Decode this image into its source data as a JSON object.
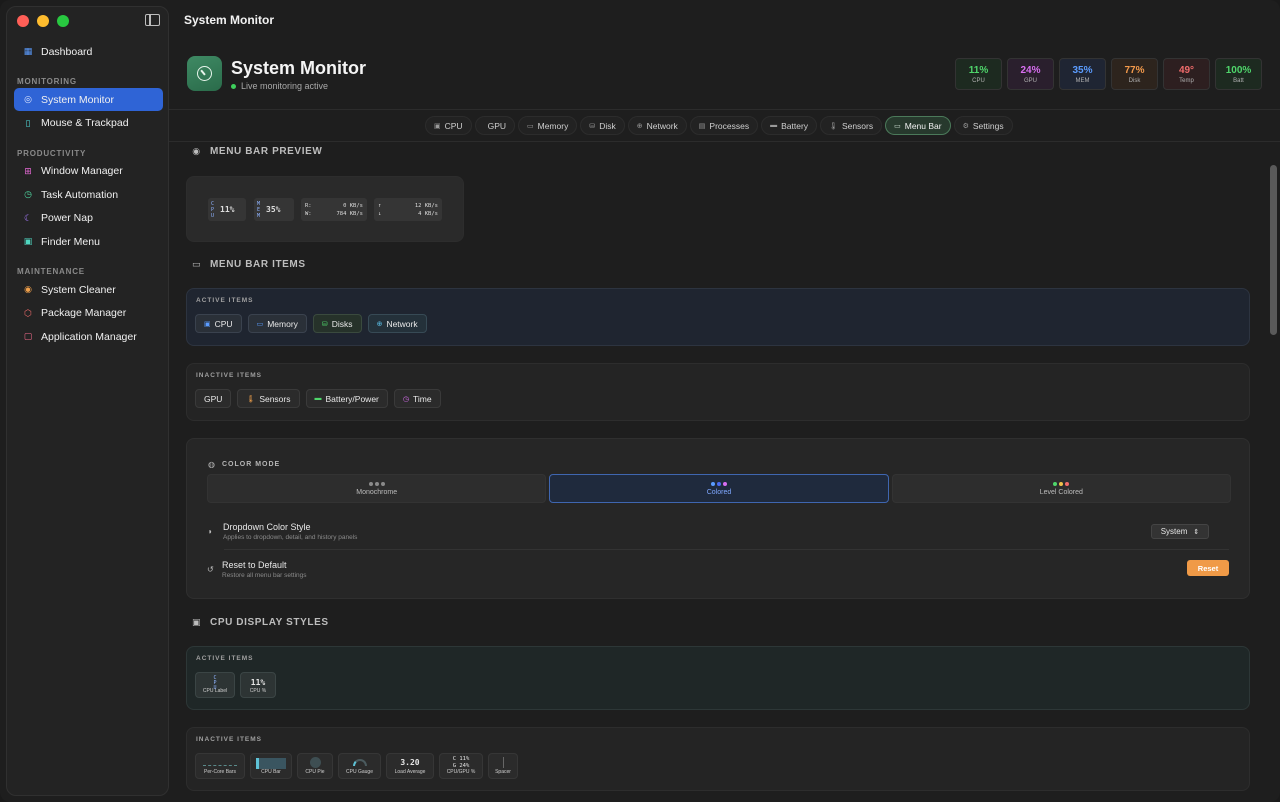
{
  "window": {
    "title": "System Monitor"
  },
  "sidebar": {
    "top": [
      {
        "label": "Dashboard",
        "icon": "grid-icon"
      }
    ],
    "sections": [
      {
        "title": "MONITORING",
        "items": [
          {
            "label": "System Monitor",
            "icon": "gauge-icon",
            "active": true
          },
          {
            "label": "Mouse & Trackpad",
            "icon": "mouse-icon"
          }
        ]
      },
      {
        "title": "PRODUCTIVITY",
        "items": [
          {
            "label": "Window Manager",
            "icon": "windows-icon"
          },
          {
            "label": "Task Automation",
            "icon": "clock-icon"
          },
          {
            "label": "Power Nap",
            "icon": "moon-icon"
          },
          {
            "label": "Finder Menu",
            "icon": "finder-icon"
          }
        ]
      },
      {
        "title": "MAINTENANCE",
        "items": [
          {
            "label": "System Cleaner",
            "icon": "broom-icon"
          },
          {
            "label": "Package Manager",
            "icon": "package-icon"
          },
          {
            "label": "Application Manager",
            "icon": "app-icon"
          }
        ]
      }
    ]
  },
  "header": {
    "title": "System Monitor",
    "status": "Live monitoring active",
    "stats": [
      {
        "value": "11%",
        "label": "CPU",
        "color": "#4fd66b"
      },
      {
        "value": "24%",
        "label": "GPU",
        "color": "#d86ef0"
      },
      {
        "value": "35%",
        "label": "MEM",
        "color": "#5b9cff"
      },
      {
        "value": "77%",
        "label": "Disk",
        "color": "#f39a4b"
      },
      {
        "value": "49°",
        "label": "Temp",
        "color": "#f06b6b"
      },
      {
        "value": "100%",
        "label": "Batt",
        "color": "#4fd66b"
      }
    ]
  },
  "tabs": [
    {
      "label": "CPU",
      "icon": "▣"
    },
    {
      "label": "GPU",
      "icon": ""
    },
    {
      "label": "Memory",
      "icon": "▭"
    },
    {
      "label": "Disk",
      "icon": "⛁"
    },
    {
      "label": "Network",
      "icon": "⊕"
    },
    {
      "label": "Processes",
      "icon": "▤"
    },
    {
      "label": "Battery",
      "icon": "▬"
    },
    {
      "label": "Sensors",
      "icon": "🌡"
    },
    {
      "label": "Menu Bar",
      "icon": "▭",
      "active": true
    },
    {
      "label": "Settings",
      "icon": "⚙"
    }
  ],
  "preview": {
    "title": "MENU BAR PREVIEW",
    "cpu": {
      "label": [
        "C",
        "P",
        "U"
      ],
      "value": "11%"
    },
    "mem": {
      "label": [
        "M",
        "E",
        "M"
      ],
      "value": "35%"
    },
    "disk": {
      "r": "R:",
      "r_val": "0 KB/s",
      "w": "W:",
      "w_val": "784 KB/s"
    },
    "net": {
      "up": "↑",
      "up_val": "12 KB/s",
      "down": "↓",
      "down_val": "4 KB/s"
    }
  },
  "menu_bar_items": {
    "title": "MENU BAR ITEMS",
    "active_label": "ACTIVE ITEMS",
    "active": [
      {
        "label": "CPU",
        "icon": "▣"
      },
      {
        "label": "Memory",
        "icon": "▭"
      },
      {
        "label": "Disks",
        "icon": "⛁"
      },
      {
        "label": "Network",
        "icon": "⊕"
      }
    ],
    "inactive_label": "INACTIVE ITEMS",
    "inactive": [
      {
        "label": "GPU",
        "icon": ""
      },
      {
        "label": "Sensors",
        "icon": "🌡"
      },
      {
        "label": "Battery/Power",
        "icon": "▬"
      },
      {
        "label": "Time",
        "icon": "◷"
      }
    ]
  },
  "color_mode": {
    "label": "COLOR MODE",
    "options": [
      {
        "label": "Monochrome",
        "dots": [
          "#8a8a8a",
          "#8a8a8a",
          "#8a8a8a"
        ]
      },
      {
        "label": "Colored",
        "dots": [
          "#5b9cff",
          "#4a6cf0",
          "#d86ef0"
        ],
        "active": true
      },
      {
        "label": "Level Colored",
        "dots": [
          "#4fd66b",
          "#f0c04b",
          "#f06b6b"
        ]
      }
    ],
    "dropdown_title": "Dropdown Color Style",
    "dropdown_sub": "Applies to dropdown, detail, and history panels",
    "dropdown_value": "System",
    "reset_title": "Reset to Default",
    "reset_sub": "Restore all menu bar settings",
    "reset_button": "Reset"
  },
  "cpu_styles": {
    "title": "CPU DISPLAY STYLES",
    "active_label": "ACTIVE ITEMS",
    "active": [
      {
        "label": "CPU Label",
        "visual": "C\nP\nU"
      },
      {
        "label": "CPU %",
        "visual": "11%"
      }
    ],
    "inactive_label": "INACTIVE ITEMS",
    "inactive": [
      {
        "label": "Per-Core Bars",
        "visual": ""
      },
      {
        "label": "CPU Bar",
        "visual": ""
      },
      {
        "label": "CPU Pie",
        "visual": ""
      },
      {
        "label": "CPU Gauge",
        "visual": ""
      },
      {
        "label": "Load Average",
        "visual": "3.20"
      },
      {
        "label": "CPU/GPU %",
        "visual": "C 11%\nG 24%"
      },
      {
        "label": "Spacer",
        "visual": ""
      }
    ]
  }
}
